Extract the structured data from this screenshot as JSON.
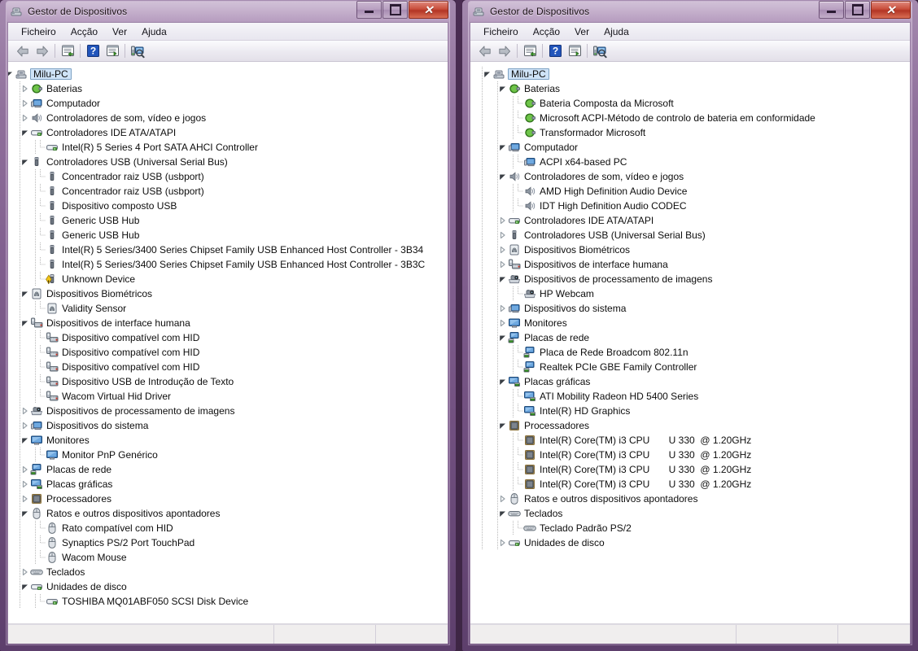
{
  "window_title": "Gestor de Dispositivos",
  "menu": [
    "Ficheiro",
    "Acção",
    "Ver",
    "Ajuda"
  ],
  "toolbar_icons": [
    "back-arrow-icon",
    "forward-arrow-icon",
    "properties-icon",
    "help-icon",
    "show-hidden-icon",
    "scan-hardware-icon"
  ],
  "caption_buttons": {
    "minimize": "minimize-button",
    "maximize": "maximize-button",
    "close": "close-button",
    "close_glyph": "✕"
  },
  "colors": {
    "accent": "#7e5c8c",
    "selection": "#cfe3f7",
    "title_text": "#1b1016",
    "close_red": "#c94f3c"
  },
  "left_window": {
    "root": "Milu-PC",
    "tree": [
      {
        "label": "Milu-PC",
        "level": 0,
        "state": "expanded",
        "icon": "computer-root-icon",
        "selected": true
      },
      {
        "label": "Baterias",
        "level": 1,
        "state": "collapsed",
        "icon": "battery-icon"
      },
      {
        "label": "Computador",
        "level": 1,
        "state": "collapsed",
        "icon": "computer-icon"
      },
      {
        "label": "Controladores de som, vídeo e jogos",
        "level": 1,
        "state": "collapsed",
        "icon": "sound-icon"
      },
      {
        "label": "Controladores IDE ATA/ATAPI",
        "level": 1,
        "state": "expanded",
        "icon": "ide-icon"
      },
      {
        "label": "Intel(R) 5 Series 4 Port SATA AHCI Controller",
        "level": 2,
        "state": "leaf",
        "icon": "ide-icon"
      },
      {
        "label": "Controladores USB (Universal Serial Bus)",
        "level": 1,
        "state": "expanded",
        "icon": "usb-icon"
      },
      {
        "label": "Concentrador raiz USB (usbport)",
        "level": 2,
        "state": "leaf",
        "icon": "usb-icon"
      },
      {
        "label": "Concentrador raiz USB (usbport)",
        "level": 2,
        "state": "leaf",
        "icon": "usb-icon"
      },
      {
        "label": "Dispositivo composto USB",
        "level": 2,
        "state": "leaf",
        "icon": "usb-icon"
      },
      {
        "label": "Generic USB Hub",
        "level": 2,
        "state": "leaf",
        "icon": "usb-icon"
      },
      {
        "label": "Generic USB Hub",
        "level": 2,
        "state": "leaf",
        "icon": "usb-icon"
      },
      {
        "label": "Intel(R) 5 Series/3400 Series Chipset Family USB Enhanced Host Controller - 3B34",
        "level": 2,
        "state": "leaf",
        "icon": "usb-icon"
      },
      {
        "label": "Intel(R) 5 Series/3400 Series Chipset Family USB Enhanced Host Controller - 3B3C",
        "level": 2,
        "state": "leaf",
        "icon": "usb-icon"
      },
      {
        "label": "Unknown Device",
        "level": 2,
        "state": "leaf",
        "icon": "usb-warning-icon"
      },
      {
        "label": "Dispositivos Biométricos",
        "level": 1,
        "state": "expanded",
        "icon": "biometric-icon"
      },
      {
        "label": "Validity Sensor",
        "level": 2,
        "state": "leaf",
        "icon": "biometric-icon"
      },
      {
        "label": "Dispositivos de interface humana",
        "level": 1,
        "state": "expanded",
        "icon": "hid-icon"
      },
      {
        "label": "Dispositivo compatível com HID",
        "level": 2,
        "state": "leaf",
        "icon": "hid-icon"
      },
      {
        "label": "Dispositivo compatível com HID",
        "level": 2,
        "state": "leaf",
        "icon": "hid-icon"
      },
      {
        "label": "Dispositivo compatível com HID",
        "level": 2,
        "state": "leaf",
        "icon": "hid-icon"
      },
      {
        "label": "Dispositivo USB de Introdução de Texto",
        "level": 2,
        "state": "leaf",
        "icon": "hid-icon"
      },
      {
        "label": "Wacom Virtual Hid Driver",
        "level": 2,
        "state": "leaf",
        "icon": "hid-icon"
      },
      {
        "label": "Dispositivos de processamento de imagens",
        "level": 1,
        "state": "collapsed",
        "icon": "camera-icon"
      },
      {
        "label": "Dispositivos do sistema",
        "level": 1,
        "state": "collapsed",
        "icon": "computer-icon"
      },
      {
        "label": "Monitores",
        "level": 1,
        "state": "expanded",
        "icon": "monitor-icon"
      },
      {
        "label": "Monitor PnP Genérico",
        "level": 2,
        "state": "leaf",
        "icon": "monitor-icon"
      },
      {
        "label": "Placas de rede",
        "level": 1,
        "state": "collapsed",
        "icon": "network-icon"
      },
      {
        "label": "Placas gráficas",
        "level": 1,
        "state": "collapsed",
        "icon": "display-icon"
      },
      {
        "label": "Processadores",
        "level": 1,
        "state": "collapsed",
        "icon": "cpu-icon"
      },
      {
        "label": "Ratos e outros dispositivos apontadores",
        "level": 1,
        "state": "expanded",
        "icon": "mouse-icon"
      },
      {
        "label": "Rato compatível com HID",
        "level": 2,
        "state": "leaf",
        "icon": "mouse-icon"
      },
      {
        "label": "Synaptics PS/2 Port TouchPad",
        "level": 2,
        "state": "leaf",
        "icon": "mouse-icon"
      },
      {
        "label": "Wacom Mouse",
        "level": 2,
        "state": "leaf",
        "icon": "mouse-icon"
      },
      {
        "label": "Teclados",
        "level": 1,
        "state": "collapsed",
        "icon": "keyboard-icon"
      },
      {
        "label": "Unidades de disco",
        "level": 1,
        "state": "expanded",
        "icon": "disk-icon"
      },
      {
        "label": "TOSHIBA MQ01ABF050 SCSI Disk Device",
        "level": 2,
        "state": "leaf",
        "icon": "disk-icon"
      }
    ]
  },
  "right_window": {
    "root": "Milu-PC",
    "tree": [
      {
        "label": "Milu-PC",
        "level": 0,
        "state": "expanded",
        "icon": "computer-root-icon",
        "selected": true
      },
      {
        "label": "Baterias",
        "level": 1,
        "state": "expanded",
        "icon": "battery-icon"
      },
      {
        "label": "Bateria Composta da Microsoft",
        "level": 2,
        "state": "leaf",
        "icon": "battery-icon"
      },
      {
        "label": "Microsoft ACPI-Método de controlo de bateria em conformidade",
        "level": 2,
        "state": "leaf",
        "icon": "battery-icon"
      },
      {
        "label": "Transformador Microsoft",
        "level": 2,
        "state": "leaf",
        "icon": "battery-icon"
      },
      {
        "label": "Computador",
        "level": 1,
        "state": "expanded",
        "icon": "computer-icon"
      },
      {
        "label": "ACPI x64-based PC",
        "level": 2,
        "state": "leaf",
        "icon": "computer-icon"
      },
      {
        "label": "Controladores de som, vídeo e jogos",
        "level": 1,
        "state": "expanded",
        "icon": "sound-icon"
      },
      {
        "label": "AMD High Definition Audio Device",
        "level": 2,
        "state": "leaf",
        "icon": "sound-icon"
      },
      {
        "label": "IDT High Definition Audio CODEC",
        "level": 2,
        "state": "leaf",
        "icon": "sound-icon"
      },
      {
        "label": "Controladores IDE ATA/ATAPI",
        "level": 1,
        "state": "collapsed",
        "icon": "ide-icon"
      },
      {
        "label": "Controladores USB (Universal Serial Bus)",
        "level": 1,
        "state": "collapsed",
        "icon": "usb-icon"
      },
      {
        "label": "Dispositivos Biométricos",
        "level": 1,
        "state": "collapsed",
        "icon": "biometric-icon"
      },
      {
        "label": "Dispositivos de interface humana",
        "level": 1,
        "state": "collapsed",
        "icon": "hid-icon"
      },
      {
        "label": "Dispositivos de processamento de imagens",
        "level": 1,
        "state": "expanded",
        "icon": "camera-icon"
      },
      {
        "label": "HP Webcam",
        "level": 2,
        "state": "leaf",
        "icon": "camera-icon"
      },
      {
        "label": "Dispositivos do sistema",
        "level": 1,
        "state": "collapsed",
        "icon": "computer-icon"
      },
      {
        "label": "Monitores",
        "level": 1,
        "state": "collapsed",
        "icon": "monitor-icon"
      },
      {
        "label": "Placas de rede",
        "level": 1,
        "state": "expanded",
        "icon": "network-icon"
      },
      {
        "label": "Placa de Rede Broadcom 802.11n",
        "level": 2,
        "state": "leaf",
        "icon": "network-icon"
      },
      {
        "label": "Realtek PCIe GBE Family Controller",
        "level": 2,
        "state": "leaf",
        "icon": "network-icon"
      },
      {
        "label": "Placas gráficas",
        "level": 1,
        "state": "expanded",
        "icon": "display-icon"
      },
      {
        "label": "ATI Mobility Radeon HD 5400 Series",
        "level": 2,
        "state": "leaf",
        "icon": "display-icon"
      },
      {
        "label": "Intel(R) HD Graphics",
        "level": 2,
        "state": "leaf",
        "icon": "display-icon"
      },
      {
        "label": "Processadores",
        "level": 1,
        "state": "expanded",
        "icon": "cpu-icon"
      },
      {
        "label": "Intel(R) Core(TM) i3 CPU       U 330  @ 1.20GHz",
        "level": 2,
        "state": "leaf",
        "icon": "cpu-icon"
      },
      {
        "label": "Intel(R) Core(TM) i3 CPU       U 330  @ 1.20GHz",
        "level": 2,
        "state": "leaf",
        "icon": "cpu-icon"
      },
      {
        "label": "Intel(R) Core(TM) i3 CPU       U 330  @ 1.20GHz",
        "level": 2,
        "state": "leaf",
        "icon": "cpu-icon"
      },
      {
        "label": "Intel(R) Core(TM) i3 CPU       U 330  @ 1.20GHz",
        "level": 2,
        "state": "leaf",
        "icon": "cpu-icon"
      },
      {
        "label": "Ratos e outros dispositivos apontadores",
        "level": 1,
        "state": "collapsed",
        "icon": "mouse-icon"
      },
      {
        "label": "Teclados",
        "level": 1,
        "state": "expanded",
        "icon": "keyboard-icon"
      },
      {
        "label": "Teclado Padrão PS/2",
        "level": 2,
        "state": "leaf",
        "icon": "keyboard-icon"
      },
      {
        "label": "Unidades de disco",
        "level": 1,
        "state": "collapsed",
        "icon": "disk-icon"
      }
    ]
  }
}
